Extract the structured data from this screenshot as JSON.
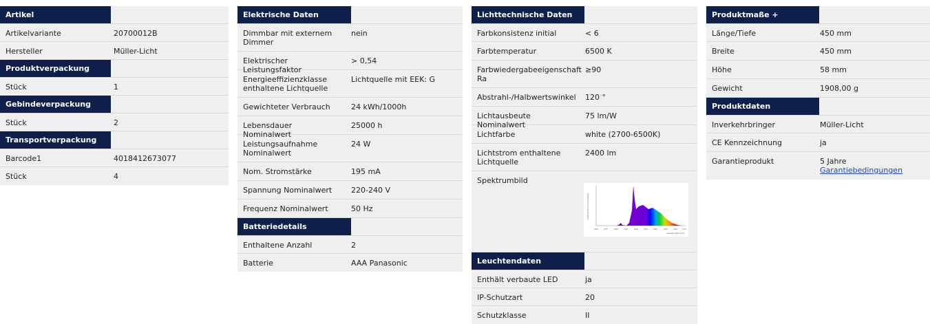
{
  "col1": {
    "sections": [
      {
        "title": "Artikel",
        "rows": [
          {
            "k": "Artikelvariante",
            "v": "20700012B"
          },
          {
            "k": "Hersteller",
            "v": "Müller-Licht"
          }
        ]
      },
      {
        "title": "Produktverpackung",
        "rows": [
          {
            "k": "Stück",
            "v": "1"
          }
        ]
      },
      {
        "title": "Gebindeverpackung",
        "rows": [
          {
            "k": "Stück",
            "v": "2"
          }
        ]
      },
      {
        "title": "Transportverpackung",
        "rows": [
          {
            "k": "Barcode1",
            "v": "4018412673077"
          },
          {
            "k": "Stück",
            "v": "4"
          }
        ]
      }
    ]
  },
  "col2": {
    "sections": [
      {
        "title": "Elektrische Daten",
        "rows": [
          {
            "k": "Dimmbar mit externem Dimmer",
            "v": "nein"
          },
          {
            "k": "Elektrischer Leistungsfaktor",
            "v": "> 0,54"
          },
          {
            "k": "Energieeffizienzklasse enthaltene Lichtquelle",
            "v": "Lichtquelle mit EEK: G"
          },
          {
            "k": "Gewichteter Verbrauch",
            "v": "24 kWh/1000h"
          },
          {
            "k": "Lebensdauer Nominalwert",
            "v": "25000 h"
          },
          {
            "k": "Leistungsaufnahme Nominalwert",
            "v": "24 W"
          },
          {
            "k": "Nom. Stromstärke",
            "v": "195 mA"
          },
          {
            "k": "Spannung Nominalwert",
            "v": "220-240 V"
          },
          {
            "k": "Frequenz Nominalwert",
            "v": "50 Hz"
          }
        ]
      },
      {
        "title": "Batteriedetails",
        "rows": [
          {
            "k": "Enthaltene Anzahl",
            "v": "2"
          },
          {
            "k": "Batterie",
            "v": "AAA Panasonic"
          }
        ]
      }
    ]
  },
  "col3": {
    "sections": [
      {
        "title": "Lichttechnische Daten",
        "rows": [
          {
            "k": "Farbkonsistenz initial",
            "v": "< 6"
          },
          {
            "k": "Farbtemperatur",
            "v": "6500 K"
          },
          {
            "k": "Farbwiedergabeeigenschaft Ra",
            "v": "≥90"
          },
          {
            "k": "Abstrahl-/Halbwertswinkel",
            "v": "120 °"
          },
          {
            "k": "Lichtausbeute Nominalwert",
            "v": "75 lm/W"
          },
          {
            "k": "Lichtfarbe",
            "v": "white (2700-6500K)"
          },
          {
            "k": "Lichtstrom enthaltene Lichtquelle",
            "v": "2400 lm"
          },
          {
            "k": "Spektrumbild",
            "v": ""
          }
        ]
      },
      {
        "title": "Leuchtendaten",
        "rows": [
          {
            "k": "Enthält verbaute LED",
            "v": "ja"
          },
          {
            "k": "IP-Schutzart",
            "v": "20"
          },
          {
            "k": "Schutzklasse",
            "v": "II"
          }
        ]
      }
    ]
  },
  "col4": {
    "sections": [
      {
        "title": "Produktmaße + Gewicht",
        "rows": [
          {
            "k": "Länge/Tiefe",
            "v": "450 mm"
          },
          {
            "k": "Breite",
            "v": "450 mm"
          },
          {
            "k": "Höhe",
            "v": "58 mm"
          },
          {
            "k": "Gewicht",
            "v": "1908,00 g"
          }
        ]
      },
      {
        "title": "Produktdaten",
        "rows": [
          {
            "k": "Inverkehrbringer",
            "v": "Müller-Licht"
          },
          {
            "k": "CE Kennzeichnung",
            "v": "ja"
          },
          {
            "k": "Garantieprodukt",
            "v": "5 Jahre",
            "link": "Garantiebedingungen"
          }
        ]
      }
    ]
  },
  "spectrum": {
    "ylabel": "relative Flux [normalized]",
    "xlabel": "wavelength [nm]",
    "ticks": [
      "250",
      "275",
      "300",
      "425",
      "450",
      "475",
      "500",
      "525",
      "550",
      "575"
    ]
  }
}
